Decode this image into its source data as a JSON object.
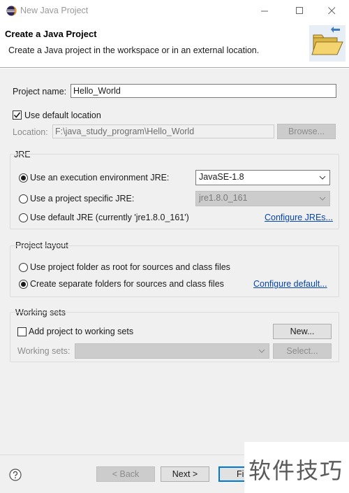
{
  "window": {
    "title": "New Java Project",
    "icon": "eclipse-icon",
    "controls": [
      "minimize-icon",
      "maximize-icon",
      "close-icon"
    ]
  },
  "header": {
    "title": "Create a Java Project",
    "description": "Create a Java project in the workspace or in an external location.",
    "icon": "wizard-folder-icon"
  },
  "project": {
    "name_label": "Project name:",
    "name_value": "Hello_World",
    "use_default_location_label": "Use default location",
    "use_default_location_checked": true,
    "location_label": "Location:",
    "location_value": "F:\\java_study_program\\Hello_World",
    "browse_label": "Browse..."
  },
  "jre": {
    "group_title": "JRE",
    "option_env_label": "Use an execution environment JRE:",
    "option_env_value": "JavaSE-1.8",
    "option_specific_label": "Use a project specific JRE:",
    "option_specific_value": "jre1.8.0_161",
    "option_default_label": "Use default JRE (currently 'jre1.8.0_161')",
    "configure_link": "Configure JREs...",
    "selected": "env"
  },
  "layout": {
    "group_title": "Project layout",
    "option_root_label": "Use project folder as root for sources and class files",
    "option_separate_label": "Create separate folders for sources and class files",
    "configure_link": "Configure default...",
    "selected": "separate"
  },
  "working_sets": {
    "group_title": "Working sets",
    "add_label": "Add project to working sets",
    "add_checked": false,
    "new_button": "New...",
    "sets_label": "Working sets:",
    "sets_value": "",
    "select_button": "Select..."
  },
  "footer": {
    "back_button": "< Back",
    "next_button": "Next >",
    "finish_button": "Fi"
  },
  "watermark": {
    "text": "软件技巧"
  },
  "colors": {
    "link": "#0645ad",
    "panel_bg": "#f0f0f0",
    "primary_border": "#0078d7"
  }
}
